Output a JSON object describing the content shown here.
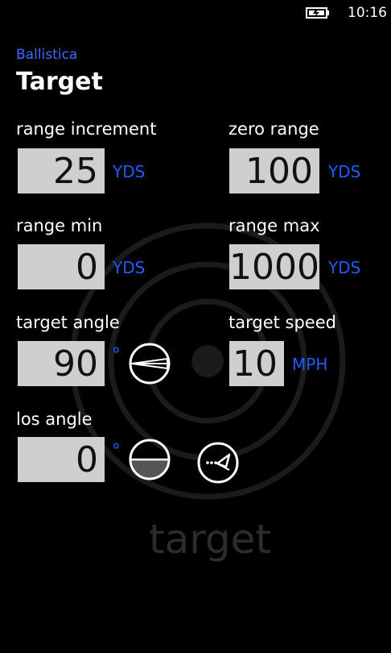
{
  "status": {
    "time": "10:16",
    "icons": [
      "battery-charging-icon"
    ]
  },
  "app": {
    "name": "Ballistica",
    "page_title": "Target",
    "watermark": "target"
  },
  "fields": {
    "range_increment": {
      "label": "range increment",
      "value": "25",
      "unit": "YDS"
    },
    "zero_range": {
      "label": "zero range",
      "value": "100",
      "unit": "YDS"
    },
    "range_min": {
      "label": "range min",
      "value": "0",
      "unit": "YDS"
    },
    "range_max": {
      "label": "range max",
      "value": "1000",
      "unit": "YDS"
    },
    "target_angle": {
      "label": "target angle",
      "value": "90",
      "unit": "°"
    },
    "target_speed": {
      "label": "target speed",
      "value": "10",
      "unit": "MPH"
    },
    "los_angle": {
      "label": "los angle",
      "value": "0",
      "unit": "°"
    }
  },
  "icons": {
    "target_angle_icon": "target-angle-icon",
    "los_angle_icon": "los-angle-icon",
    "los_diagram_icon": "los-diagram-icon"
  },
  "colors": {
    "accent": "#1f5cff",
    "app_title": "#3d6dff",
    "field_bg": "#cfcfcf",
    "background": "#000000"
  }
}
